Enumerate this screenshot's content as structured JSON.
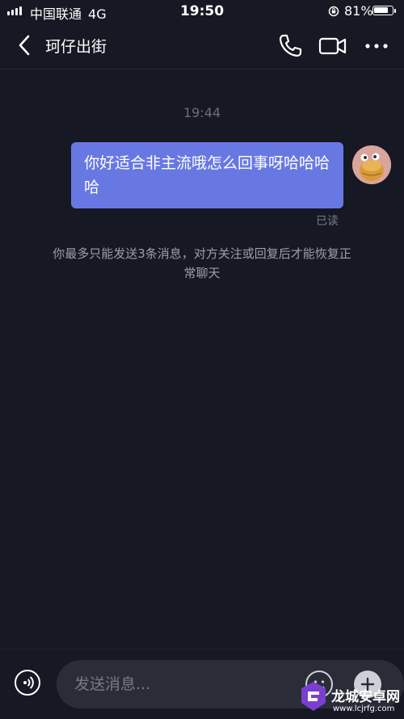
{
  "status_bar": {
    "carrier": "中国联通",
    "network": "4G",
    "time": "19:50",
    "battery_percent_label": "81%",
    "battery_level": 0.81
  },
  "header": {
    "title": "珂仔出街",
    "icons": [
      "back-arrow-icon",
      "phone-icon",
      "video-camera-icon",
      "more-dots-icon"
    ]
  },
  "chat": {
    "timestamp": "19:44",
    "messages": [
      {
        "sender": "me",
        "text": "你好适合非主流哦怎么回事呀哈哈哈哈",
        "status": "已读",
        "bubble_color": "#6878e3"
      }
    ],
    "system_notice": "你最多只能发送3条消息，对方关注或回复后才能恢复正常聊天"
  },
  "input": {
    "placeholder": "发送消息..."
  },
  "watermark": {
    "name": "龙城安卓网",
    "url": "www.lcjrfg.com"
  },
  "colors": {
    "background": "#161823",
    "accent": "#6878e3",
    "input_bg": "#2a2d38"
  }
}
